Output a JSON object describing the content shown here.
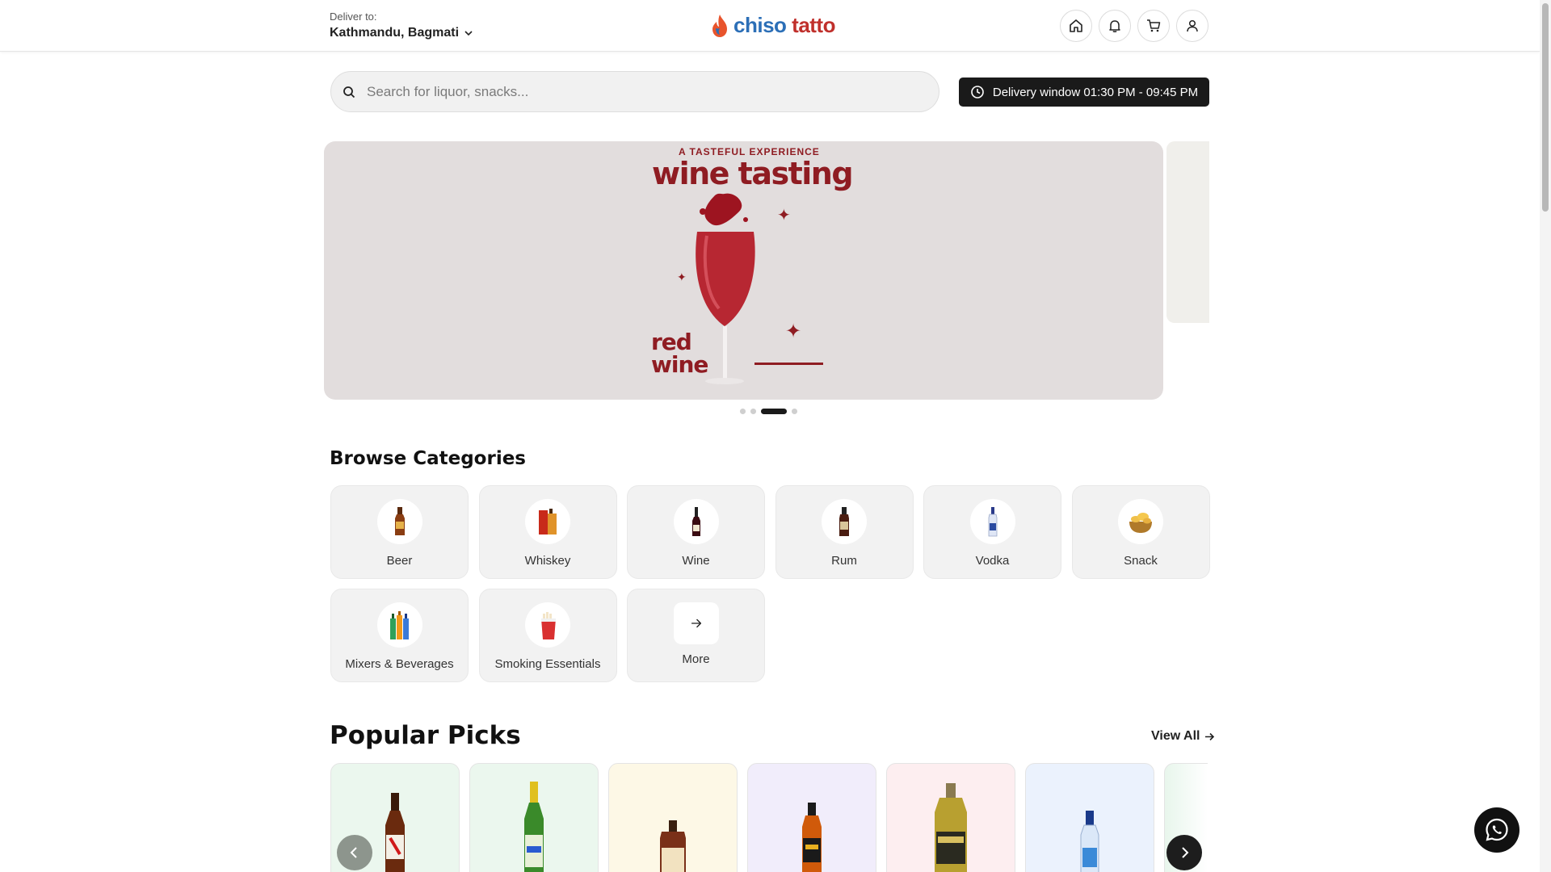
{
  "header": {
    "deliver_label": "Deliver to:",
    "location": "Kathmandu, Bagmati",
    "logo_first": "chiso",
    "logo_second": "tatto",
    "icons": [
      "home-icon",
      "bell-icon",
      "cart-icon",
      "user-icon"
    ]
  },
  "search": {
    "placeholder": "Search for liquor, snacks..."
  },
  "delivery_window": {
    "label": "Delivery window 01:30 PM - 09:45 PM"
  },
  "banner": {
    "kicker": "A TASTEFUL EXPERIENCE",
    "title": "wine tasting",
    "sub_line1": "red",
    "sub_line2": "wine",
    "slides_total": 4,
    "active_slide": 3
  },
  "categories": {
    "title": "Browse Categories",
    "items": [
      {
        "label": "Beer",
        "icon": "beer-bottle-icon"
      },
      {
        "label": "Whiskey",
        "icon": "whiskey-box-icon"
      },
      {
        "label": "Wine",
        "icon": "wine-bottle-icon"
      },
      {
        "label": "Rum",
        "icon": "rum-bottle-icon"
      },
      {
        "label": "Vodka",
        "icon": "vodka-bottle-icon"
      },
      {
        "label": "Snack",
        "icon": "snack-bowl-icon"
      },
      {
        "label": "Mixers & Beverages",
        "icon": "mixers-bottles-icon"
      },
      {
        "label": "Smoking Essentials",
        "icon": "cigarette-pack-icon"
      },
      {
        "label": "More",
        "icon": "arrow-right-icon"
      }
    ]
  },
  "popular": {
    "title": "Popular Picks",
    "view_all": "View All",
    "card_colors": [
      "#ebf7ee",
      "#ebf7ee",
      "#fdf8e6",
      "#f1edfb",
      "#fdeef0",
      "#ebf2fd"
    ]
  },
  "colors": {
    "brand_red": "#c0302c",
    "brand_blue": "#2c6fb7",
    "banner_wine": "#8f1c22",
    "dark": "#1a1a1a"
  }
}
